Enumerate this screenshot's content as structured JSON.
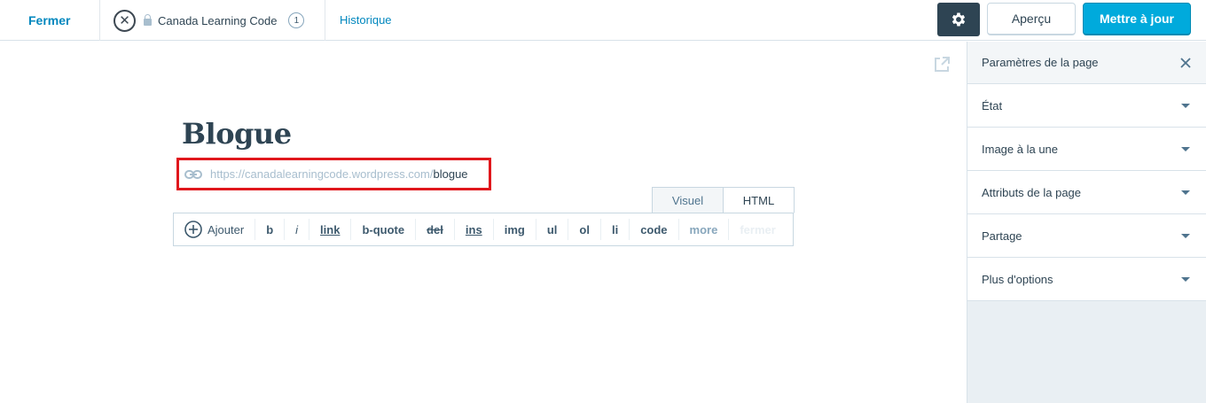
{
  "topbar": {
    "close_label": "Fermer",
    "site_logo_glyph": "✕",
    "site_name": "Canada Learning Code",
    "site_count": "1",
    "history_label": "Historique",
    "preview_label": "Aperçu",
    "update_label": "Mettre à jour"
  },
  "editor": {
    "title": "Blogue",
    "permalink_base": "https://canadalearningcode.wordpress.com/",
    "permalink_slug": "blogue",
    "tabs": {
      "visual": "Visuel",
      "html": "HTML"
    },
    "toolbar": {
      "add": "Ajouter",
      "b": "b",
      "i": "i",
      "link": "link",
      "bquote": "b-quote",
      "del": "del",
      "ins": "ins",
      "img": "img",
      "ul": "ul",
      "ol": "ol",
      "li": "li",
      "code": "code",
      "more": "more",
      "close_tags": "fermer"
    }
  },
  "sidebar": {
    "title": "Paramètres de la page",
    "panels": [
      "État",
      "Image à la une",
      "Attributs de la page",
      "Partage",
      "Plus d'options"
    ]
  },
  "colors": {
    "accent": "#00aadc",
    "link": "#0087be",
    "highlight_border": "#e0171c",
    "dark": "#2e4453"
  }
}
